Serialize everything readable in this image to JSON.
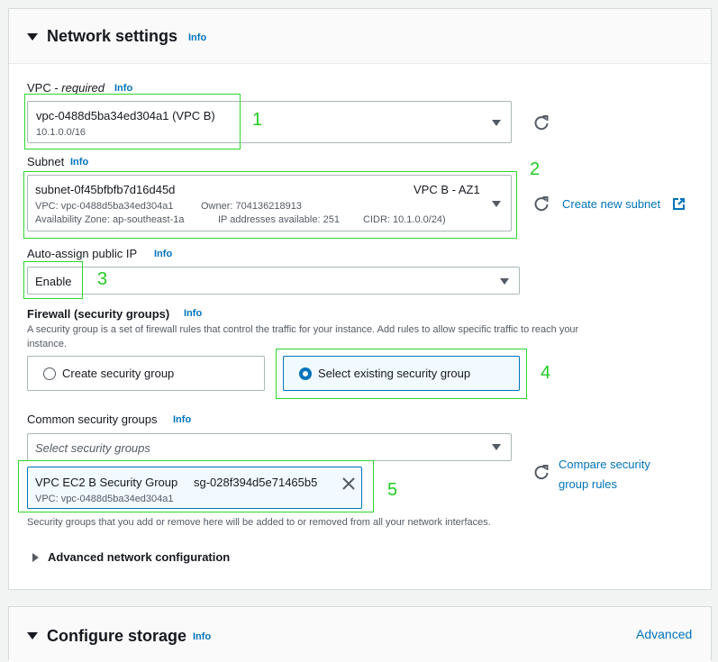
{
  "network": {
    "title": "Network settings",
    "info": "Info",
    "vpc": {
      "label": "VPC - ",
      "required": "required",
      "info": "Info",
      "value": "vpc-0488d5ba34ed304a1 (VPC B)",
      "sub": "10.1.0.0/16"
    },
    "subnet": {
      "label": "Subnet",
      "info": "Info",
      "value": "subnet-0f45bfbfb7d16d45d",
      "name": "VPC B - AZ1",
      "vpc": "VPC: vpc-0488d5ba34ed304a1",
      "owner": "Owner: 704136218913",
      "az": "Availability Zone: ap-southeast-1a",
      "ips": "IP addresses available: 251",
      "cidr": "CIDR: 10.1.0.0/24)",
      "create_link": "Create new subnet"
    },
    "public_ip": {
      "label": "Auto-assign public IP",
      "info": "Info",
      "value": "Enable"
    },
    "firewall": {
      "label": "Firewall (security groups)",
      "info": "Info",
      "description_line1": "A security group is a set of firewall rules that control the traffic for your instance. Add rules to allow specific traffic to reach your",
      "description_line2": "instance.",
      "options": [
        "Create security group",
        "Select existing security group"
      ],
      "selected_index": 1
    },
    "common_sg": {
      "label": "Common security groups",
      "info": "Info",
      "placeholder": "Select security groups",
      "token_name": "VPC EC2 B Security Group",
      "token_id": "sg-028f394d5e71465b5",
      "token_vpc": "VPC: vpc-0488d5ba34ed304a1",
      "compare_line1": "Compare security",
      "compare_line2": "group rules",
      "note": "Security groups that you add or remove here will be added to or removed from all your network interfaces."
    },
    "advanced": "Advanced network configuration"
  },
  "storage": {
    "title": "Configure storage",
    "info": "Info",
    "advanced_link": "Advanced"
  },
  "annotations": [
    "1",
    "2",
    "3",
    "4",
    "5"
  ],
  "colors": {
    "accent": "#0073bb",
    "annotation": "#22cc22",
    "selected_bg": "#f1faff"
  }
}
